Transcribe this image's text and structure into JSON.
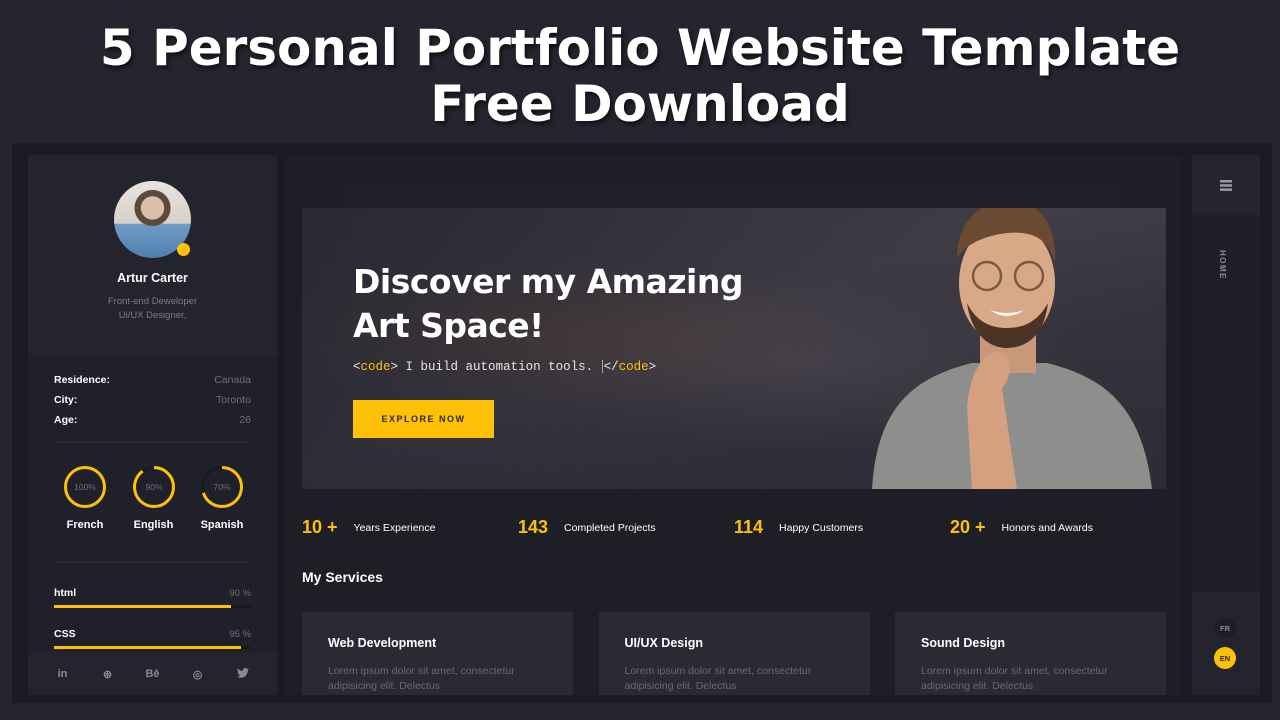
{
  "banner": {
    "line1": "5 Personal Portfolio Website Template",
    "line2": "Free Download"
  },
  "profile": {
    "name": "Artur Carter",
    "role_line1": "Front-end Deweloper",
    "role_line2": "Ui/UX Designer,",
    "status_color": "#ffc107"
  },
  "info": [
    {
      "key": "Residence:",
      "value": "Canada"
    },
    {
      "key": "City:",
      "value": "Toronto"
    },
    {
      "key": "Age:",
      "value": "26"
    }
  ],
  "languages": [
    {
      "name": "French",
      "percent": 100,
      "label": "100%"
    },
    {
      "name": "English",
      "percent": 90,
      "label": "90%"
    },
    {
      "name": "Spanish",
      "percent": 70,
      "label": "70%"
    }
  ],
  "skills": [
    {
      "name": "html",
      "percent": 90,
      "label": "90 %"
    },
    {
      "name": "CSS",
      "percent": 95,
      "label": "95 %"
    }
  ],
  "social": [
    {
      "icon": "linkedin-icon",
      "glyph": "in"
    },
    {
      "icon": "dribbble-icon",
      "glyph": "⊛"
    },
    {
      "icon": "behance-icon",
      "glyph": "Bē"
    },
    {
      "icon": "github-icon",
      "glyph": "◎"
    },
    {
      "icon": "twitter-icon",
      "glyph": "🐦"
    }
  ],
  "hero": {
    "title_line1": "Discover my Amazing",
    "title_line2": "Art Space!",
    "code_open": "code",
    "code_text": " I build automation tools. ",
    "code_close": "code",
    "button": "EXPLORE NOW"
  },
  "stats": [
    {
      "value": "10 +",
      "label": "Years Experience"
    },
    {
      "value": "143",
      "label": "Completed Projects"
    },
    {
      "value": "114",
      "label": "Happy Customers"
    },
    {
      "value": "20 +",
      "label": "Honors and Awards"
    }
  ],
  "services": {
    "title": "My Services",
    "items": [
      {
        "title": "Web Development",
        "desc": "Lorem ipsum dolor sit amet, consectetur adipisicing elit. Delectus"
      },
      {
        "title": "UI/UX Design",
        "desc": "Lorem ipsum dolor sit amet, consectetur adipisicing elit. Delectus"
      },
      {
        "title": "Sound Design",
        "desc": "Lorem ipsum dolor sit amet, consectetur adipisicing elit. Delectus"
      }
    ]
  },
  "nav": {
    "current": "HOME",
    "lang_options": [
      "FR",
      "EN"
    ],
    "active_lang": "EN"
  },
  "colors": {
    "accent": "#ffc107",
    "bg": "#1e1e27",
    "panel": "#24242e"
  }
}
